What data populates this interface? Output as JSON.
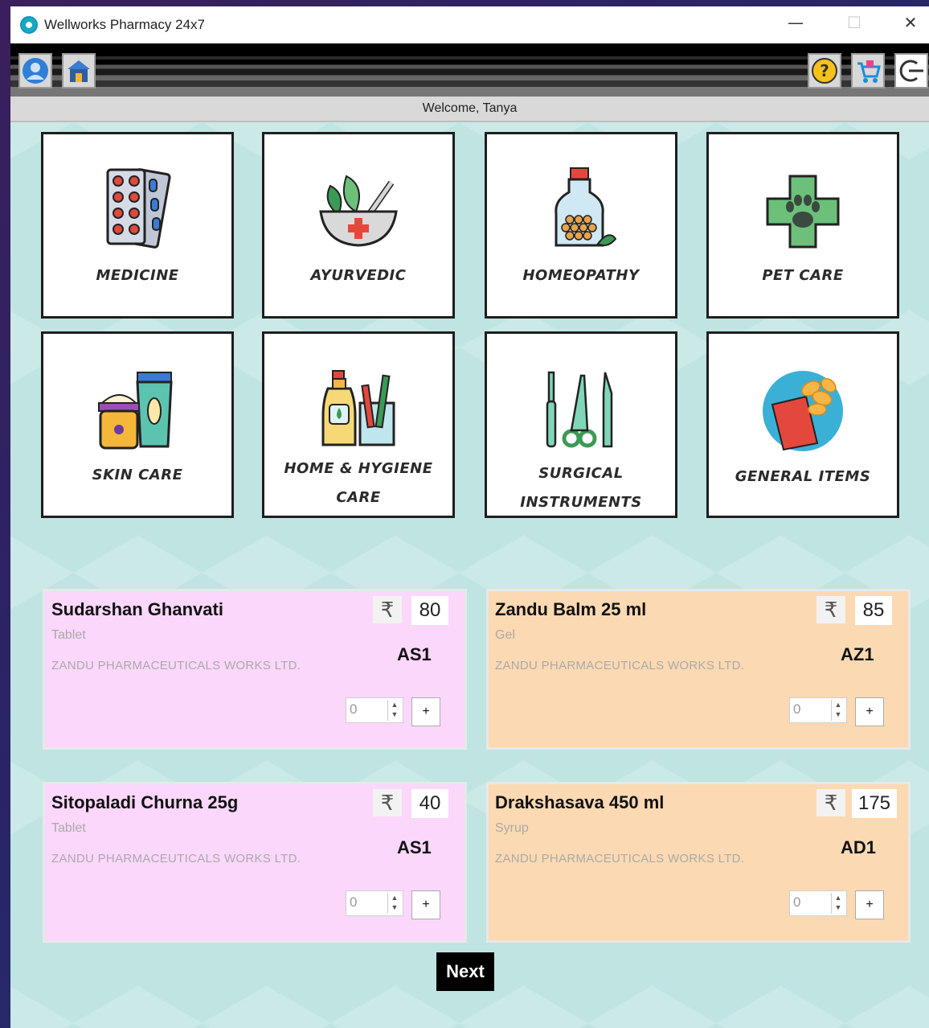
{
  "window": {
    "title": "Wellworks Pharmacy 24x7",
    "minimize": "—",
    "maximize": "☐",
    "close": "✕"
  },
  "toolbar": {
    "left_icons": [
      "user-profile-icon",
      "store-home-icon"
    ],
    "right_icons": [
      "help-icon",
      "cart-icon",
      "logout-icon"
    ]
  },
  "welcome": "Welcome, Tanya",
  "categories": [
    {
      "label": "MEDICINE",
      "icon": "pill-blister-icon"
    },
    {
      "label": "AYURVEDIC",
      "icon": "mortar-herb-icon"
    },
    {
      "label": "HOMEOPATHY",
      "icon": "bottle-globules-icon"
    },
    {
      "label": "PET CARE",
      "icon": "paw-cross-icon"
    },
    {
      "label": "SKIN CARE",
      "icon": "cream-tube-icon"
    },
    {
      "label_line1": "HOME & HYGIENE",
      "label_line2": "CARE",
      "icon": "soap-toothbrush-icon"
    },
    {
      "label_line1": "SURGICAL",
      "label_line2": "INSTRUMENTS",
      "icon": "surgical-tools-icon"
    },
    {
      "label": "GENERAL ITEMS",
      "icon": "chips-packet-icon"
    }
  ],
  "products": [
    {
      "name": "Sudarshan Ghanvati",
      "form": "Tablet",
      "manufacturer": "ZANDU PHARMACEUTICALS WORKS LTD.",
      "currency": "₹",
      "price": "80",
      "code": "AS1",
      "quantity": "0",
      "add_label": "+",
      "color": "#fbd7fb"
    },
    {
      "name": "Zandu Balm 25 ml",
      "form": "Gel",
      "manufacturer": "ZANDU PHARMACEUTICALS WORKS LTD.",
      "currency": "₹",
      "price": "85",
      "code": "AZ1",
      "quantity": "0",
      "add_label": "+",
      "color": "#fbd9b2"
    },
    {
      "name": "Sitopaladi Churna 25g",
      "form": "Tablet",
      "manufacturer": "ZANDU PHARMACEUTICALS WORKS LTD.",
      "currency": "₹",
      "price": "40",
      "code": "AS1",
      "quantity": "0",
      "add_label": "+",
      "color": "#fbd7fb"
    },
    {
      "name": "Drakshasava 450 ml",
      "form": "Syrup",
      "manufacturer": "ZANDU PHARMACEUTICALS WORKS LTD.",
      "currency": "₹",
      "price": "175",
      "code": "AD1",
      "quantity": "0",
      "add_label": "+",
      "color": "#fbd9b2"
    }
  ],
  "next_label": "Next"
}
